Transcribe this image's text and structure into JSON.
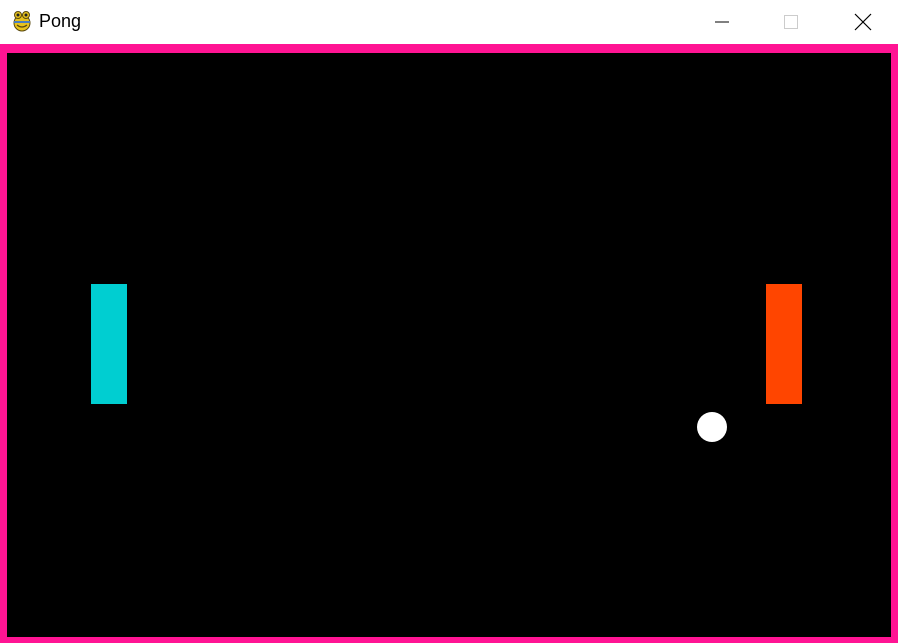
{
  "window": {
    "title": "Pong",
    "icon": "pygame-snake-icon",
    "controls": {
      "minimize_icon": "minimize-icon",
      "maximize_icon": "maximize-icon",
      "close_icon": "close-icon"
    }
  },
  "game": {
    "border_color": "#ff1493",
    "background_color": "#000000",
    "left_paddle_color": "#00ced1",
    "right_paddle_color": "#ff4500",
    "ball_color": "#ffffff"
  }
}
